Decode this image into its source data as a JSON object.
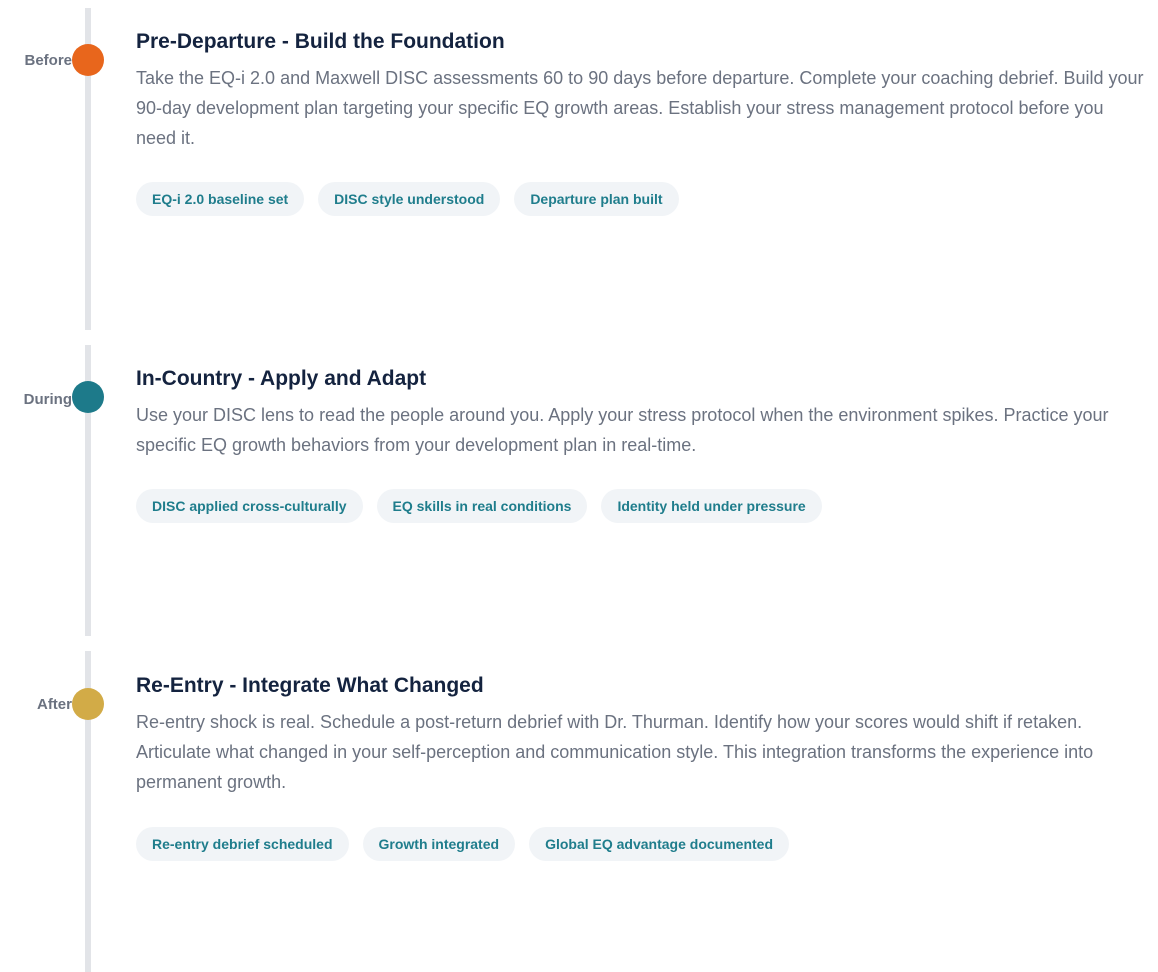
{
  "phases": [
    {
      "label": "Before",
      "title": "Pre-Departure - Build the Foundation",
      "body": "Take the EQ-i 2.0 and Maxwell DISC assessments 60 to 90 days before departure. Complete your coaching debrief. Build your 90-day development plan targeting your specific EQ growth areas. Establish your stress management protocol before you need it.",
      "tags": [
        "EQ-i 2.0 baseline set",
        "DISC style understood",
        "Departure plan built"
      ],
      "dot_color": "#e8661c"
    },
    {
      "label": "During",
      "title": "In-Country - Apply and Adapt",
      "body": "Use your DISC lens to read the people around you. Apply your stress protocol when the environment spikes. Practice your specific EQ growth behaviors from your development plan in real-time.",
      "tags": [
        "DISC applied cross-culturally",
        "EQ skills in real conditions",
        "Identity held under pressure"
      ],
      "dot_color": "#1d7a8a"
    },
    {
      "label": "After",
      "title": "Re-Entry - Integrate What Changed",
      "body": "Re-entry shock is real. Schedule a post-return debrief with Dr. Thurman. Identify how your scores would shift if retaken. Articulate what changed in your self-perception and communication style. This integration transforms the experience into permanent growth.",
      "tags": [
        "Re-entry debrief scheduled",
        "Growth integrated",
        "Global EQ advantage documented"
      ],
      "dot_color": "#d2ab47"
    }
  ]
}
